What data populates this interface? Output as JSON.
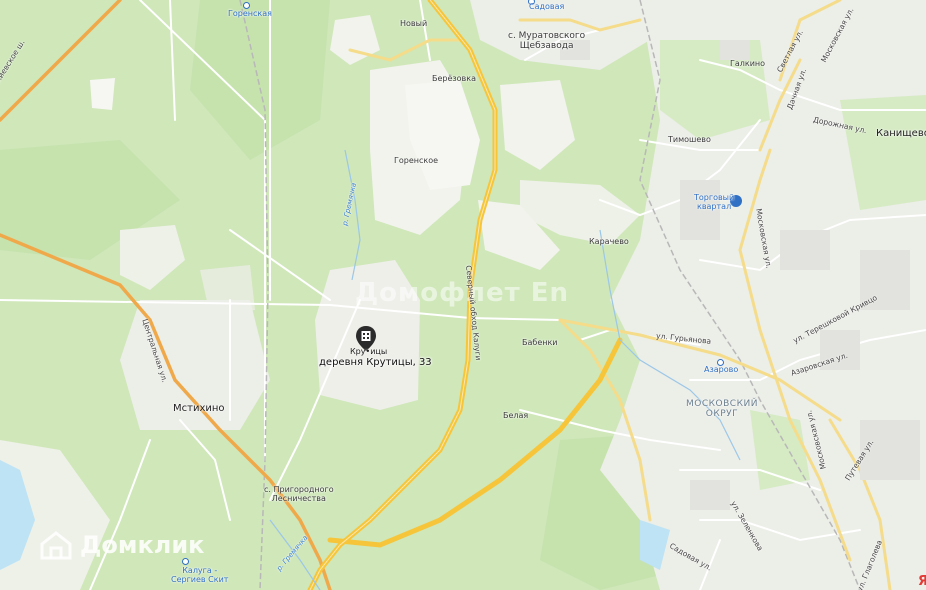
{
  "map": {
    "colors": {
      "forest": "#cfe7b9",
      "forest_dark": "#bfe0a4",
      "open": "#f2f4ee",
      "urban": "#ecece8",
      "water": "#bde3f5",
      "highway": "#f9c23c",
      "main_road": "#fbe07f",
      "minor_road": "#ffffff",
      "railway": "#a9a9a9"
    },
    "pin": {
      "icon": "building-pin-icon",
      "name": "Кру•ицы",
      "address": "деревня Крутицы, 33"
    },
    "watermark": "Домофлет Еn",
    "domclick": "Домклик",
    "brand_mark": "Я",
    "labels": {
      "gorenskaya": "Горенская",
      "sadovaya": "Садовая",
      "noviy": "Новый",
      "muratovskiy_1": "с. Муратовского",
      "muratovskiy_2": "Щебзавода",
      "berezovka": "Берёзовка",
      "galkino": "Галкино",
      "kanishchevo": "Канищево",
      "timoshevo": "Тимошево",
      "gorenskoe": "Горенское",
      "torgoviy_1": "Торговый",
      "torgoviy_2": "квартал",
      "karachevo": "Карачево",
      "babenki": "Бабенки",
      "gurjanova": "ул. Гурьянова",
      "azarovo": "Азарово",
      "moskovskiy_1": "МОСКОВСКИЙ",
      "moskovskiy_2": "ОКРУГ",
      "mstikhino": "Мстихино",
      "belaya": "Белая",
      "prigorodnoe_1": "с. Пригородного",
      "prigorodnoe_2": "Лесничества",
      "kaluga_1": "Калуга -",
      "kaluga_2": "Сергиев Скит",
      "kievskoe": "Киевское ш.",
      "centralnaya": "Центральная ул.",
      "severniy_obkhod": "Северный обход Калуги",
      "r_gremyachka": "р. Гремячка",
      "r_gremyachka_2": "р. Гремячка",
      "svetlaya": "Светлая ул.",
      "moskovskaya_top": "Московская ул.",
      "dachnaya": "Дачная ул.",
      "dorozhnaya": "Дорожная ул.",
      "moskovskaya_mid": "Московская ул.",
      "tereshkovoy": "ул. Терешковой Кривцо",
      "azarovskaya": "Азаровская ул.",
      "moskovskaya_low": "Московская ул.",
      "putevaya": "Путевая ул.",
      "zelenkova": "ул. Зеленкова",
      "sadovaya_ul": "Садовая ул.",
      "glagoleva": "ул. Глаголева"
    }
  }
}
